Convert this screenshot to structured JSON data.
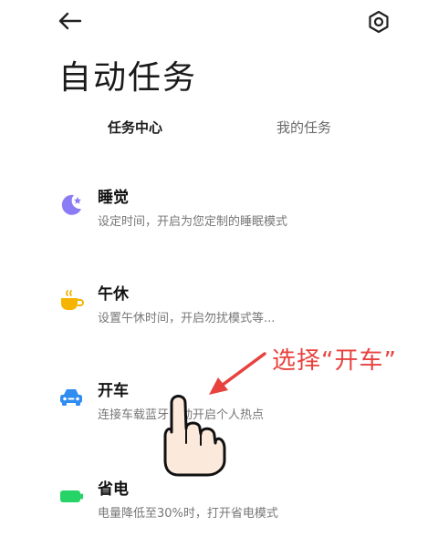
{
  "header": {
    "title": "自动任务",
    "back_icon": "back-arrow-icon",
    "settings_icon": "gear-icon"
  },
  "tabs": [
    {
      "label": "任务中心",
      "active": true
    },
    {
      "label": "我的任务",
      "active": false
    }
  ],
  "tasks": [
    {
      "title": "睡觉",
      "desc": "设定时间，开启为您定制的睡眠模式",
      "icon": "moon-star-icon",
      "color": "#8b7cf6"
    },
    {
      "title": "午休",
      "desc": "设置午休时间，开启勿扰模式等...",
      "icon": "coffee-cup-icon",
      "color": "#f5b400"
    },
    {
      "title": "开车",
      "desc": "连接车载蓝牙自动开启个人热点",
      "icon": "car-icon",
      "color": "#2f8cf0"
    },
    {
      "title": "省电",
      "desc": "电量降低至30%时，打开省电模式",
      "icon": "battery-icon",
      "color": "#25d366"
    }
  ],
  "annotation": {
    "text": "选择“开车”",
    "color": "#e8423f"
  }
}
